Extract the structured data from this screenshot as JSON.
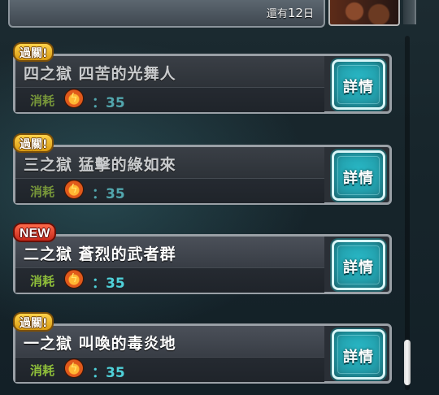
{
  "header": {
    "days_prefix": "還有",
    "days_number": "12",
    "days_suffix": "日"
  },
  "quests": [
    {
      "badge": "過關!",
      "badge_type": "cleared",
      "title": "四之獄 四苦的光舞人",
      "cost_label": "消耗",
      "stamina_icon": "stamina-icon",
      "cost_value": "：35",
      "detail_label": "詳情"
    },
    {
      "badge": "過關!",
      "badge_type": "cleared",
      "title": "三之獄 猛擊的綠如來",
      "cost_label": "消耗",
      "stamina_icon": "stamina-icon",
      "cost_value": "：35",
      "detail_label": "詳情"
    },
    {
      "badge": "NEW",
      "badge_type": "new",
      "title": "二之獄 蒼烈的武者群",
      "cost_label": "消耗",
      "stamina_icon": "stamina-icon",
      "cost_value": "：35",
      "detail_label": "詳情"
    },
    {
      "badge": "過關!",
      "badge_type": "cleared",
      "title": "一之獄 叫喚的毒炎地",
      "cost_label": "消耗",
      "stamina_icon": "stamina-icon",
      "cost_value": "：35",
      "detail_label": "詳情"
    }
  ],
  "colors": {
    "accent_cyan": "#0ea9b8",
    "cleared_badge": "#ffd24a",
    "new_badge": "#e0402a",
    "cost_value": "#4fd0d8"
  }
}
